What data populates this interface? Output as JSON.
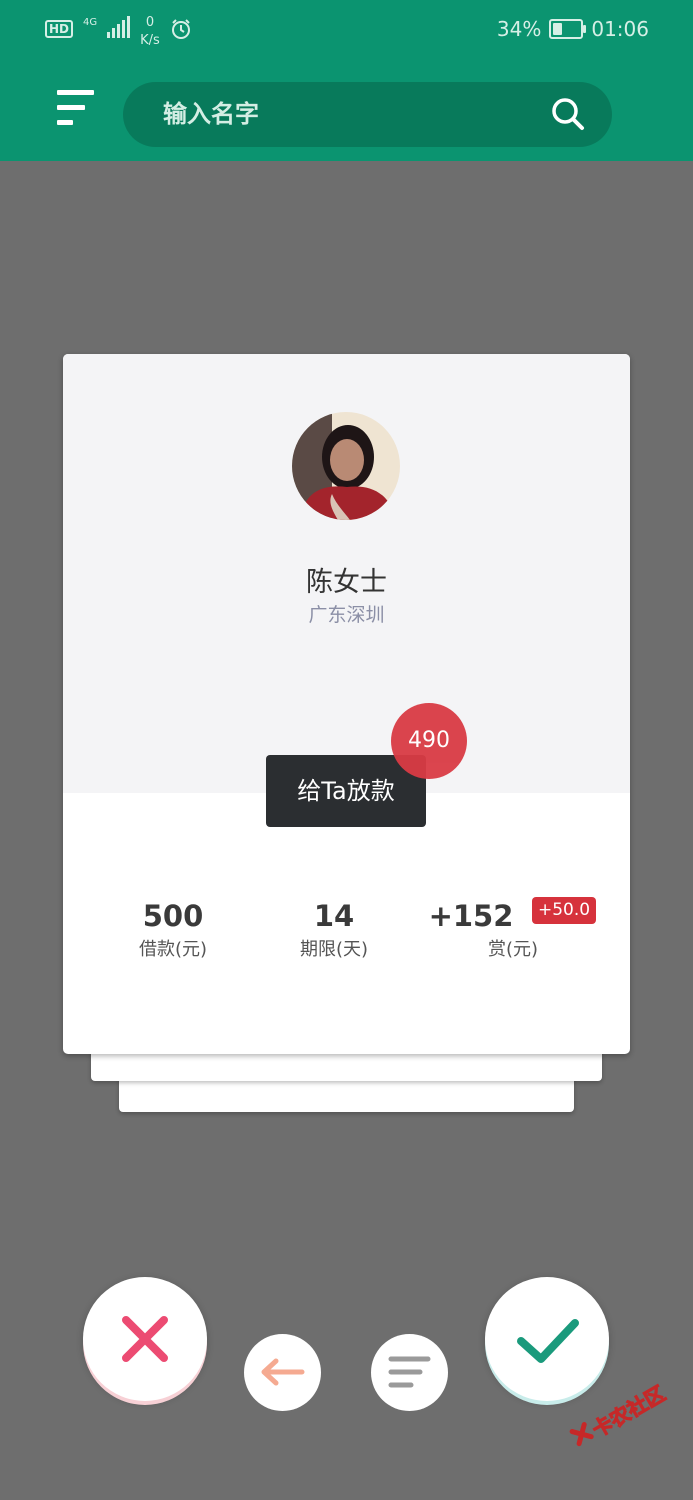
{
  "status_bar": {
    "hd": "HD",
    "network": "4G",
    "speed_value": "0",
    "speed_unit": "K/s",
    "battery_percent": "34%",
    "battery_level": 0.34,
    "time": "01:06"
  },
  "header": {
    "menu_icon": "menu-lines-icon",
    "search_placeholder": "输入名字",
    "search_icon": "search-icon",
    "bg_color": "#0b9470"
  },
  "card": {
    "avatar": "avatar-photo",
    "name": "陈女士",
    "location": "广东深圳",
    "score": "490",
    "lend_button": "给Ta放款",
    "stats": [
      {
        "value": "500",
        "label": "借款(元)"
      },
      {
        "value": "14",
        "label": "期限(天)"
      },
      {
        "value": "+152",
        "label": "赏(元)"
      }
    ],
    "bonus_badge": "+50.0"
  },
  "actions": {
    "reject_icon": "close-icon",
    "back_icon": "arrow-left-icon",
    "list_icon": "list-icon",
    "accept_icon": "check-icon",
    "reject_color": "#ec4b72",
    "accept_color": "#1a9a7c"
  },
  "watermark": {
    "text": "卡农社区"
  }
}
